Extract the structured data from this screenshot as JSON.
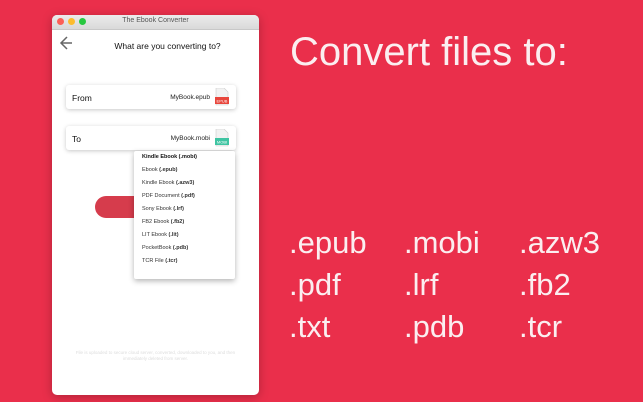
{
  "window": {
    "title": "The Ebook Converter",
    "heading": "What are you converting to?",
    "from": {
      "label": "From",
      "filename": "MyBook.epub",
      "badge": "EPUB"
    },
    "to": {
      "label": "To",
      "filename": "MyBook.mobi",
      "badge": "MOBI"
    },
    "dropdown": [
      {
        "name": "Kindle Ebook",
        "ext": "(.mobi)"
      },
      {
        "name": "Ebook",
        "ext": "(.epub)"
      },
      {
        "name": "Kindle Ebook",
        "ext": "(.azw3)"
      },
      {
        "name": "PDF Document",
        "ext": "(.pdf)"
      },
      {
        "name": "Sony Ebook",
        "ext": "(.lrf)"
      },
      {
        "name": "FB2 Ebook",
        "ext": "(.fb2)"
      },
      {
        "name": "LIT Ebook",
        "ext": "(.lit)"
      },
      {
        "name": "PocketBook",
        "ext": "(.pdb)"
      },
      {
        "name": "TCR File",
        "ext": "(.tcr)"
      }
    ],
    "footnote": "File is uploaded to secure cloud server, converted, downloaded to you, and then immediately deleted from server."
  },
  "promo": {
    "headline": "Convert files to:",
    "formats": [
      ".epub",
      ".mobi",
      ".azw3",
      ".pdf",
      ".lrf",
      ".fb2",
      ".txt",
      ".pdb",
      ".tcr"
    ]
  },
  "colors": {
    "background": "#ea2f4b",
    "epub_badge": "#e8463c",
    "mobi_badge": "#3fc4a2"
  }
}
